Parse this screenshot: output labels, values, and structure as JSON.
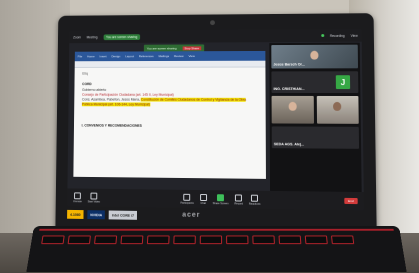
{
  "zoom": {
    "top_bar": {
      "left_labels": [
        "Zoom",
        "Meeting"
      ],
      "share_pill": "You are screen sharing",
      "right_labels": [
        "Recording",
        "View"
      ]
    },
    "share_notice": {
      "text": "You are screen sharing",
      "stop_label": "Stop Share"
    },
    "document": {
      "ribbon_items": [
        "File",
        "Home",
        "Insert",
        "Design",
        "Layout",
        "References",
        "Mailings",
        "Review",
        "View"
      ],
      "lines": {
        "tag": "Etiq",
        "heading1": "CORD",
        "line1": "Gobierno abierto",
        "line2": "Consejo de Participación Ciudadana (art. 145 II, Ley Municipal)",
        "line3_plain": "Cons. Asambea, Pabellon, Jesús María,",
        "line3_highlight": "Constitución de Comités Ciudadanos de Control y Vigilancia de la Obra Pública Municipal (art. 106-144, Ley Municipal)",
        "heading2": "I. CONVENIOS Y RECOMENDACIONES"
      }
    },
    "participants": [
      {
        "name": "Jesús Barsch Or...",
        "kind": "video"
      },
      {
        "name": "ING. CRISTHIAN...",
        "kind": "avatar",
        "initial": "J"
      },
      {
        "name": "",
        "kind": "video"
      },
      {
        "name": "",
        "kind": "video"
      },
      {
        "name": "SEDA AGS. Alej...",
        "kind": "none"
      }
    ],
    "toolbar": {
      "items": [
        "Unmute",
        "Start Video",
        "Participants",
        "Chat",
        "Share Screen",
        "Record",
        "Reactions"
      ],
      "end_label": "End"
    }
  },
  "laptop": {
    "stickers": [
      "4.1080",
      "NVIDIA",
      "intel CORE i7"
    ],
    "brand": "acer"
  }
}
